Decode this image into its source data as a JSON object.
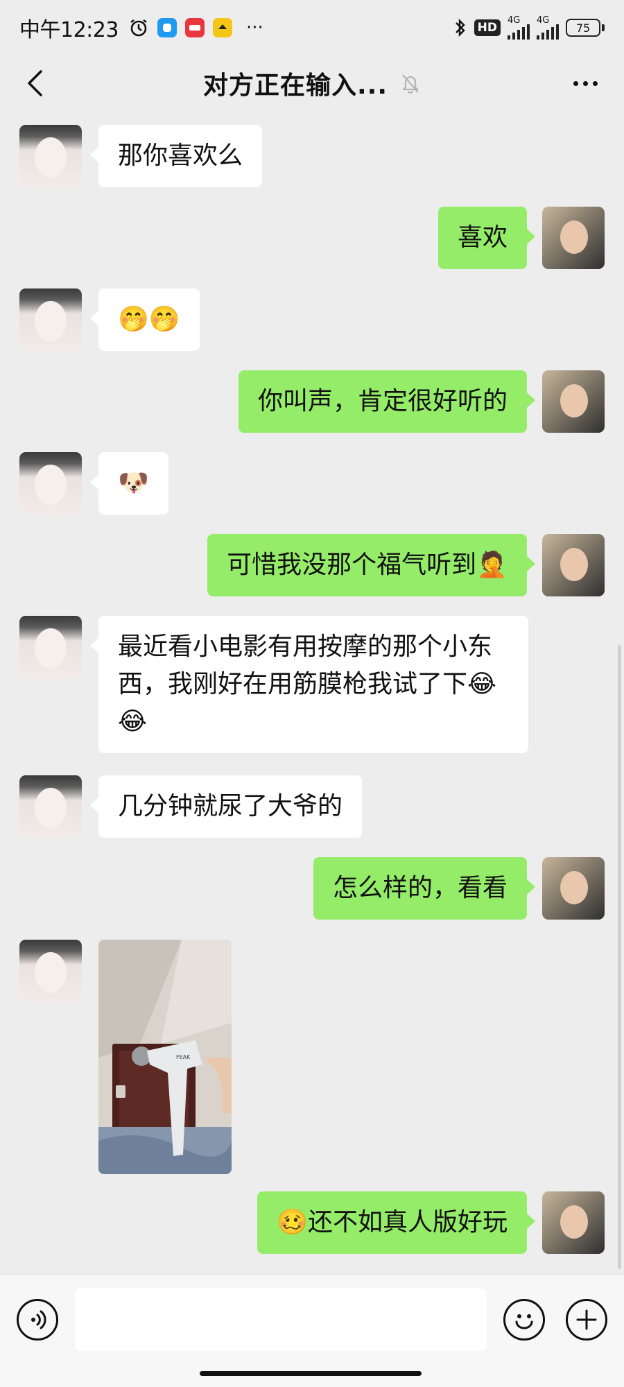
{
  "status_bar": {
    "time": "中午12:23",
    "dots": "···",
    "hd_label": "HD",
    "network_1": "4G",
    "network_2": "4G",
    "battery": "75"
  },
  "nav": {
    "title": "对方正在输入..."
  },
  "messages": [
    {
      "side": "left",
      "text": "那你喜欢么"
    },
    {
      "side": "right",
      "text": "喜欢"
    },
    {
      "side": "left",
      "text": "🤭🤭"
    },
    {
      "side": "right",
      "text": "你叫声，肯定很好听的"
    },
    {
      "side": "left",
      "text": "🐶"
    },
    {
      "side": "right",
      "text": "可惜我没那个福气听到🤦"
    },
    {
      "side": "left",
      "text": "最近看小电影有用按摩的那个小东西，我刚好在用筋膜枪我试了下😂😂"
    },
    {
      "side": "left",
      "text": "几分钟就尿了大爷的"
    },
    {
      "side": "right",
      "text": "怎么样的，看看"
    },
    {
      "side": "left",
      "type": "image",
      "brand_text": "FEAK"
    },
    {
      "side": "right",
      "text": "🥴还不如真人版好玩"
    }
  ],
  "colors": {
    "background": "#ededed",
    "bubble_right": "#95ec69",
    "bubble_left": "#ffffff"
  }
}
